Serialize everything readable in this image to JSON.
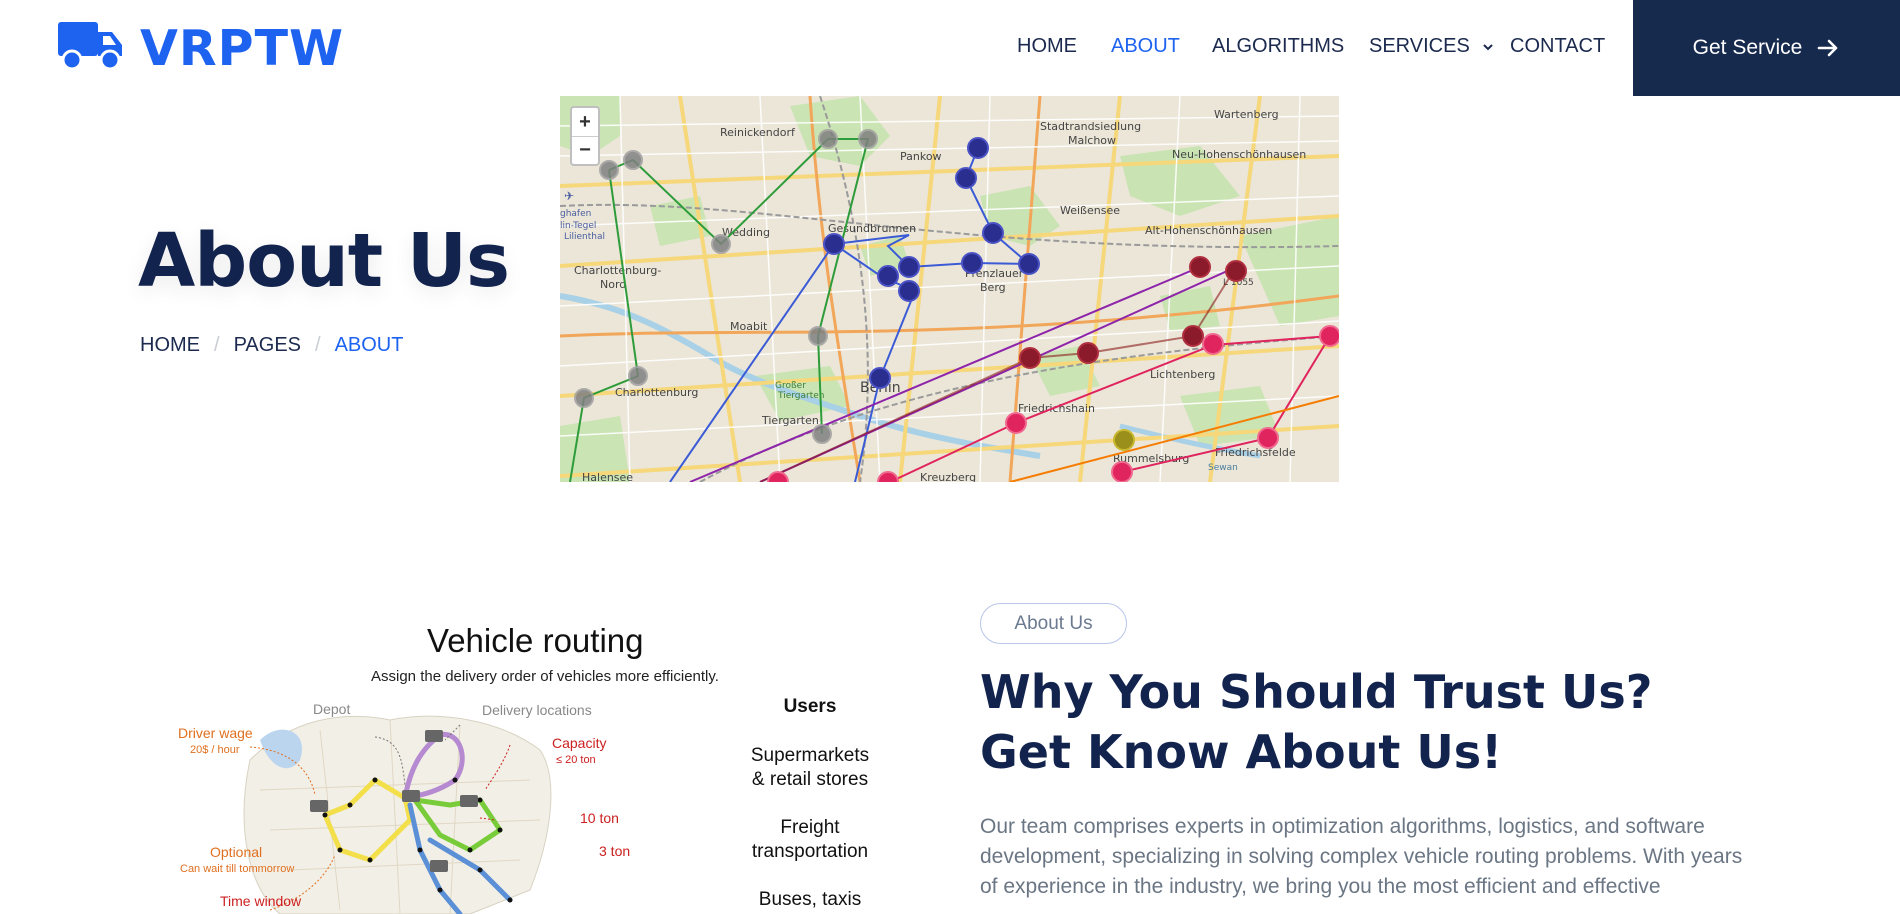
{
  "brand": {
    "name": "VRPTW",
    "icon": "truck-icon",
    "color": "#1d63f0"
  },
  "nav": {
    "items": [
      {
        "label": "HOME",
        "active": false
      },
      {
        "label": "ABOUT",
        "active": true
      },
      {
        "label": "ALGORITHMS",
        "active": false
      },
      {
        "label": "SERVICES",
        "active": false,
        "has_dropdown": true
      },
      {
        "label": "CONTACT",
        "active": false
      }
    ],
    "cta": {
      "label": "Get Service",
      "icon": "arrow-right-icon",
      "bg": "#162a4e"
    }
  },
  "hero": {
    "title": "About Us",
    "breadcrumb": [
      {
        "label": "HOME"
      },
      {
        "label": "PAGES"
      },
      {
        "label": "ABOUT",
        "current": true
      }
    ]
  },
  "map": {
    "zoom_in": "+",
    "zoom_out": "−",
    "places": [
      "Reinickendorf",
      "Pankow",
      "Stadtrandsiedlung Malchow",
      "Wartenberg",
      "Neu-Hohenschönhausen",
      "Weißensee",
      "Alt-Hohenschönhausen",
      "Wedding",
      "Gesundbrunnen",
      "Prenzlauer Berg",
      "Charlottenburg-Nord",
      "Moabit",
      "Charlottenburg",
      "Tiergarten",
      "Berlin",
      "Friedrichshain",
      "Lichtenberg",
      "Friedrichsfelde",
      "Rummelsburg",
      "Kreuzberg",
      "Halensee",
      "L 1055",
      "Großer Tiergarten",
      "Sewan",
      "ghafen",
      "lin-Tegel",
      "Lilienthal"
    ],
    "route_colors": [
      "#2e7d32",
      "#3b5bd6",
      "#8e24aa",
      "#e0245e",
      "#f57c00",
      "#8b1a1a"
    ]
  },
  "illustration": {
    "title": "Vehicle routing",
    "subtitle": "Assign the delivery order of vehicles more efficiently.",
    "labels": {
      "depot": "Depot",
      "delivery_locations": "Delivery locations",
      "driver_wage": "Driver wage",
      "driver_wage_value": "20$ / hour",
      "capacity": "Capacity",
      "capacity_value": "≤ 20 ton",
      "ton10": "10 ton",
      "ton3": "3 ton",
      "optional": "Optional",
      "optional_note": "Can wait till tommorrow",
      "time_window": "Time window"
    },
    "users": {
      "header": "Users",
      "items": [
        "Supermarkets\n& retail stores",
        "Freight\ntransportation",
        "Buses, taxis"
      ]
    }
  },
  "about": {
    "pill": "About Us",
    "heading": "Why You Should Trust Us? Get Know About Us!",
    "paragraph": "Our team comprises experts in optimization algorithms, logistics, and software development, specializing in solving complex vehicle routing problems. With years of experience in the industry, we bring you the most efficient and effective"
  }
}
